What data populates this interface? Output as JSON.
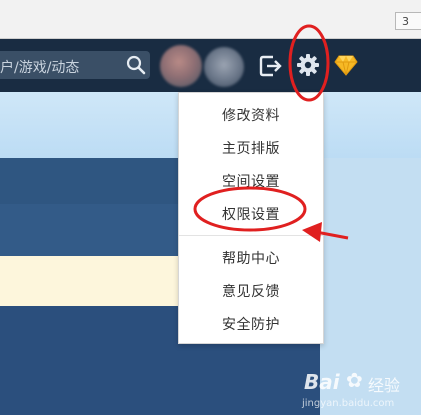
{
  "chrome": {
    "badge": "3"
  },
  "navbar": {
    "search_placeholder": "户/游戏/动态",
    "icons": [
      "search-icon",
      "logout-icon",
      "gear-icon",
      "diamond-icon"
    ]
  },
  "menu": {
    "items": [
      "修改资料",
      "主页排版",
      "空间设置",
      "权限设置",
      "帮助中心",
      "意见反馈",
      "安全防护"
    ],
    "highlighted": "权限设置"
  },
  "watermark": {
    "brand": "Bai",
    "suffix": "经验",
    "domain": "jingyan.baidu.com"
  },
  "colors": {
    "navbar": "#192c42",
    "annotation": "#e02020",
    "panel": "#2f5681",
    "cream": "#fdf6dc",
    "sky": "#c3def2"
  }
}
